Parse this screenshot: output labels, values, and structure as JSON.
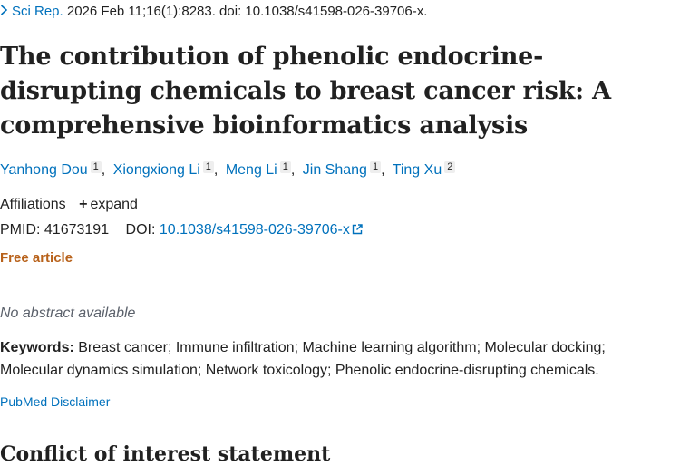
{
  "citation": {
    "journal": "Sci Rep.",
    "details": " 2026 Feb 11;16(1):8283. doi: 10.1038/s41598-026-39706-x."
  },
  "title": "The contribution of phenolic endocrine-disrupting chemicals to breast cancer risk: A comprehensive bioinformatics analysis",
  "authors": [
    {
      "name": "Yanhong Dou",
      "aff": "1"
    },
    {
      "name": "Xiongxiong Li",
      "aff": "1"
    },
    {
      "name": "Meng Li",
      "aff": "1"
    },
    {
      "name": "Jin Shang",
      "aff": "1"
    },
    {
      "name": "Ting Xu",
      "aff": "2"
    }
  ],
  "author_separator": ",",
  "affiliations": {
    "label": "Affiliations",
    "expand_label": "expand"
  },
  "ids": {
    "pmid_label": "PMID:",
    "pmid": "41673191",
    "doi_label": "DOI:",
    "doi": "10.1038/s41598-026-39706-x"
  },
  "free_article": "Free article",
  "no_abstract": "No abstract available",
  "keywords": {
    "label": "Keywords:",
    "text": "Breast cancer; Immune infiltration; Machine learning algorithm; Molecular docking; Molecular dynamics simulation; Network toxicology; Phenolic endocrine-disrupting chemicals."
  },
  "disclaimer": "PubMed Disclaimer",
  "next_heading": "Conflict of interest statement",
  "colors": {
    "link": "#0071bc",
    "free_article": "#b8621b",
    "text": "#212121",
    "muted": "#5b616b"
  },
  "icons": {
    "journal_chevron": "chevron-right-icon",
    "doi_external": "external-link-icon",
    "expand": "plus-icon"
  }
}
